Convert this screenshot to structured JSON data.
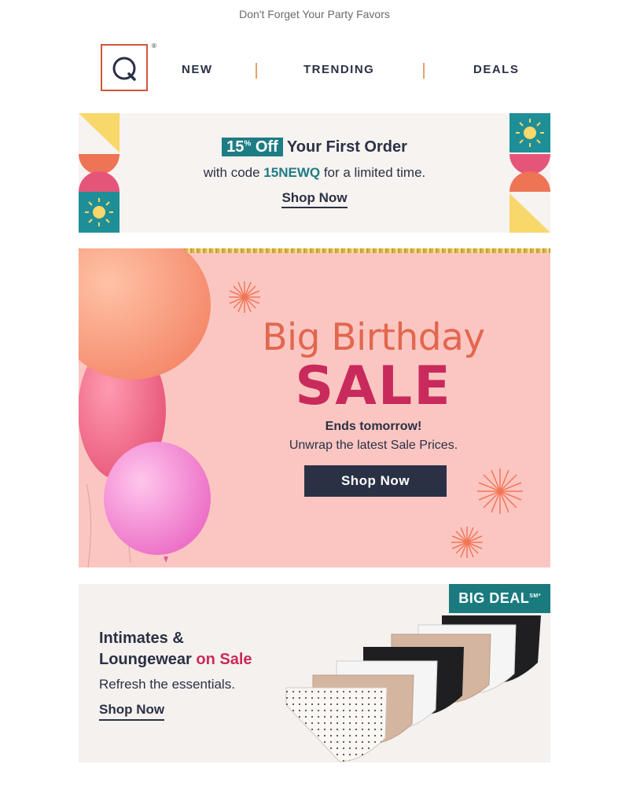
{
  "preheader": "Don't Forget Your Party Favors",
  "header": {
    "logo_letter": "Q",
    "logo_mark": "®",
    "nav": [
      {
        "label": "NEW"
      },
      {
        "label": "TRENDING"
      },
      {
        "label": "DEALS"
      }
    ]
  },
  "promo": {
    "discount": "15",
    "discount_sup": "%",
    "off_label": "Off",
    "headline_rest": " Your First Order",
    "line2_prefix": "with code ",
    "code": "15NEWQ",
    "line2_suffix": " for a limited time.",
    "link": "Shop Now"
  },
  "hero": {
    "title_line1": "Big Birthday",
    "title_line2": "SALE",
    "subtitle_bold": "Ends tomorrow!",
    "subtitle": "Unwrap the latest Sale Prices.",
    "button": "Shop Now"
  },
  "deal": {
    "badge": "BIG DEAL",
    "badge_sup": "SM*",
    "heading_line1": "Intimates &",
    "heading_line2": "Loungewear",
    "heading_accent": "on Sale",
    "subtitle": "Refresh the essentials.",
    "link": "Shop Now"
  },
  "colors": {
    "navy": "#2a3145",
    "teal": "#1e7c84",
    "coral": "#e2674e",
    "magenta": "#c92a5c",
    "hero_bg": "#fbc6c2",
    "promo_bg": "#f7f3f0"
  }
}
